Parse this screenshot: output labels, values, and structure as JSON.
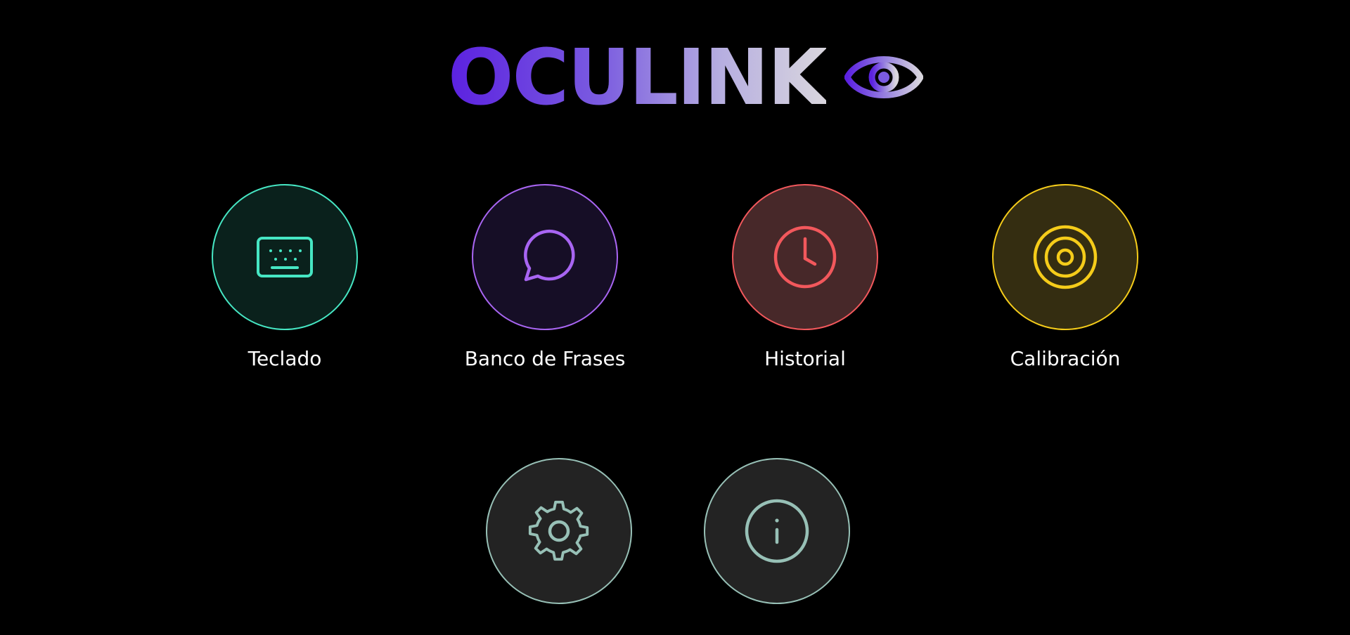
{
  "header": {
    "app_title": "OCULINK",
    "logo_icon": "eye-icon",
    "gradient_colors": [
      "#5b21e0",
      "#7a5be0",
      "#b6aee0",
      "#d9d6de"
    ]
  },
  "menu": {
    "items": [
      {
        "label": "Teclado",
        "icon": "keyboard-icon",
        "accent": "#46e6c3"
      },
      {
        "label": "Banco de Frases",
        "icon": "chat-bubble-icon",
        "accent": "#a865f2"
      },
      {
        "label": "Historial",
        "icon": "clock-icon",
        "accent": "#f2585c"
      },
      {
        "label": "Calibración",
        "icon": "target-icon",
        "accent": "#f5cc1a"
      }
    ]
  },
  "secondary": {
    "items": [
      {
        "icon": "gear-icon",
        "accent": "#97c0b6"
      },
      {
        "icon": "info-icon",
        "accent": "#97c0b6"
      }
    ]
  }
}
